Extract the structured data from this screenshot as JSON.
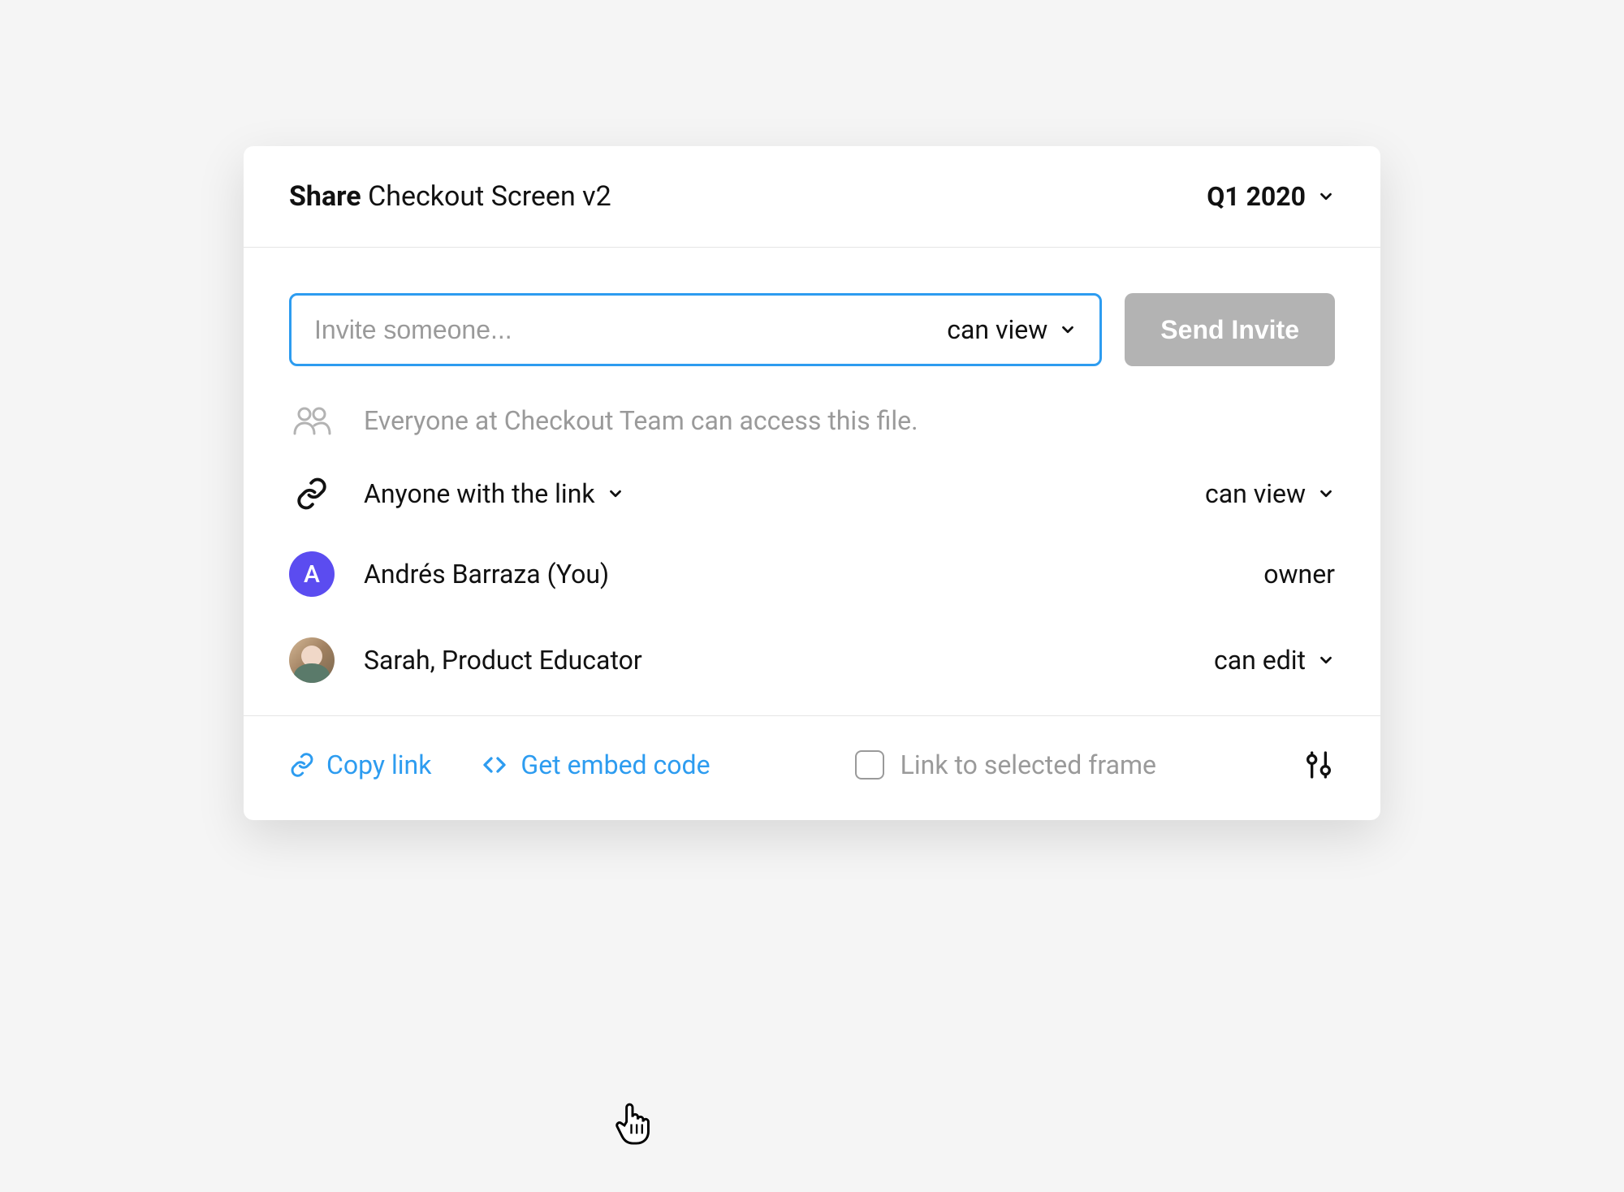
{
  "header": {
    "share_prefix": "Share",
    "file_name": "Checkout Screen v2",
    "project": "Q1 2020"
  },
  "invite": {
    "placeholder": "Invite someone...",
    "permission": "can view",
    "send_button": "Send Invite"
  },
  "team_access": {
    "text": "Everyone at Checkout Team can access this file."
  },
  "link_access": {
    "label": "Anyone with the link",
    "permission": "can view"
  },
  "users": [
    {
      "name": "Andrés Barraza (You)",
      "initial": "A",
      "role": "owner",
      "avatar_type": "initial"
    },
    {
      "name": "Sarah, Product Educator",
      "role": "can edit",
      "avatar_type": "photo"
    }
  ],
  "footer": {
    "copy_link": "Copy link",
    "embed_code": "Get embed code",
    "frame_checkbox": "Link to selected frame"
  },
  "colors": {
    "accent_blue": "#2d9cf0",
    "avatar_purple": "#5b4cf0",
    "muted_gray": "#9a9a9a"
  }
}
